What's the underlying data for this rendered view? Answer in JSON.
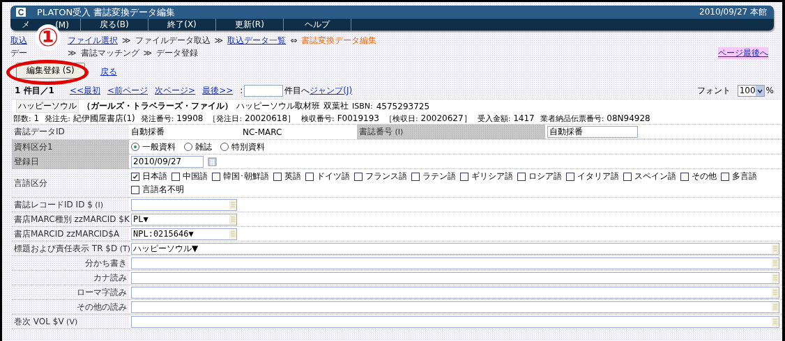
{
  "window": {
    "logo": "C",
    "title": "PLATON受入 書誌変換データ編集",
    "date": "2010/09/27 本館"
  },
  "menu": [
    {
      "parts": [
        "メ",
        "(M)"
      ]
    },
    {
      "parts": [
        "戻る(B)"
      ]
    },
    {
      "parts": [
        "終了(X)"
      ]
    },
    {
      "parts": [
        "更新(R)"
      ]
    },
    {
      "parts": [
        "ヘルプ"
      ]
    }
  ],
  "breadcrumb_1": [
    {
      "kind": "link",
      "text": "取込"
    },
    {
      "kind": "hidden"
    },
    {
      "kind": "link",
      "text": "ファイル選択"
    },
    {
      "kind": "sep",
      "text": "≫"
    },
    {
      "kind": "plain",
      "text": "ファイルデータ取込"
    },
    {
      "kind": "sep",
      "text": "≫"
    },
    {
      "kind": "link",
      "text": "取込データ一覧"
    },
    {
      "kind": "sep",
      "text": "⇔"
    },
    {
      "kind": "current",
      "text": "書誌変換データ編集"
    }
  ],
  "breadcrumb_2": [
    {
      "kind": "plain",
      "text": "デー"
    },
    {
      "kind": "hidden"
    },
    {
      "kind": "sep",
      "text": "≫"
    },
    {
      "kind": "plain",
      "text": "書誌マッチング"
    },
    {
      "kind": "sep",
      "text": "≫"
    },
    {
      "kind": "plain",
      "text": "データ登録"
    }
  ],
  "page_end_link": "ページ最後へ",
  "save_button": "編集登録 (S)",
  "back_link": "戻る",
  "callout": {
    "number": "①"
  },
  "pager": {
    "count": "1 件目／1",
    "first": "<<最初",
    "prev": "<前ページ",
    "next": "次ページ>",
    "last": "最後>>",
    "colon": ":",
    "jump_label": "件目へ",
    "jump": "ジャンプ(J)",
    "font_label": "フォント",
    "font_value": "100",
    "percent": "%"
  },
  "book": {
    "title_reading": "ハッピーソウル",
    "subtitle": "（ガールズ・トラベラーズ・ファイル）",
    "author": "ハッピーソウル取材班",
    "publisher": "双葉社",
    "isbn_label": "ISBN:",
    "isbn": "4575293725"
  },
  "order_details": [
    {
      "label": "部数:",
      "value": "1"
    },
    {
      "label": "発注先:",
      "value": "紀伊國屋書店(1)"
    },
    {
      "label": "発注番号:",
      "value": "19908"
    },
    {
      "label": "［発注日:",
      "value": "20020618］"
    },
    {
      "label": "検収番号:",
      "value": "F0019193"
    },
    {
      "label": "［検収日:",
      "value": "20020627］"
    },
    {
      "label": "受入金額:",
      "value": "1417"
    },
    {
      "label": "業者納品伝票番号:",
      "value": "08N94928"
    }
  ],
  "form": [
    {
      "kind": "id",
      "label": "書誌データID",
      "highlighted": false,
      "value": "自動採番",
      "source": "NC-MARC",
      "label_2": "書誌番号",
      "hint_2": "(I)",
      "highlighted_2": true,
      "value_2": "自動採番"
    },
    {
      "kind": "radio",
      "label": "資料区分1",
      "highlighted": true,
      "options": [
        {
          "label": "一般資料",
          "selected": true
        },
        {
          "label": "雑誌",
          "selected": false
        },
        {
          "label": "特別資料",
          "selected": false
        }
      ]
    },
    {
      "kind": "date",
      "label": "登録日",
      "highlighted": true,
      "value": "2010/09/27"
    },
    {
      "kind": "checkbox",
      "label": "言語区分",
      "highlighted": false,
      "options": [
        {
          "label": "日本語",
          "checked": true
        },
        {
          "label": "中国語",
          "checked": false
        },
        {
          "label": "韓国･朝鮮語",
          "checked": false
        },
        {
          "label": "英語",
          "checked": false
        },
        {
          "label": "ドイツ語",
          "checked": false
        },
        {
          "label": "フランス語",
          "checked": false
        },
        {
          "label": "ラテン語",
          "checked": false
        },
        {
          "label": "ギリシア語",
          "checked": false
        },
        {
          "label": "ロシア語",
          "checked": false
        },
        {
          "label": "イタリア語",
          "checked": false
        },
        {
          "label": "スペイン語",
          "checked": false
        },
        {
          "label": "その他",
          "checked": false
        },
        {
          "label": "多言語",
          "checked": false
        },
        {
          "label": "言語名不明",
          "checked": false
        }
      ]
    },
    {
      "kind": "short-input",
      "label": "書誌レコードID ID $",
      "hint": "(I)",
      "highlighted": false
    },
    {
      "kind": "short-input",
      "label": "書店MARC種別 zzMARCID $K",
      "highlighted": false,
      "value": "PL▼"
    },
    {
      "kind": "short-input",
      "label": "書店MARCID zzMARCID$A",
      "highlighted": false,
      "value": "NPL:0215646▼"
    },
    {
      "kind": "long-input",
      "label": "標題および責任表示 TR $D",
      "hint": "(T)",
      "highlighted": false,
      "value": "ハッピーソウル▼"
    },
    {
      "kind": "subfield",
      "label": "分かち書き",
      "highlighted": false
    },
    {
      "kind": "subfield",
      "label": "カナ読み",
      "highlighted": false
    },
    {
      "kind": "subfield",
      "label": "ローマ字読み",
      "highlighted": false
    },
    {
      "kind": "subfield",
      "label": "その他の読み",
      "highlighted": false
    },
    {
      "kind": "long-input",
      "label": "巻次 VOL $V",
      "hint": "(V)",
      "highlighted": false
    }
  ]
}
